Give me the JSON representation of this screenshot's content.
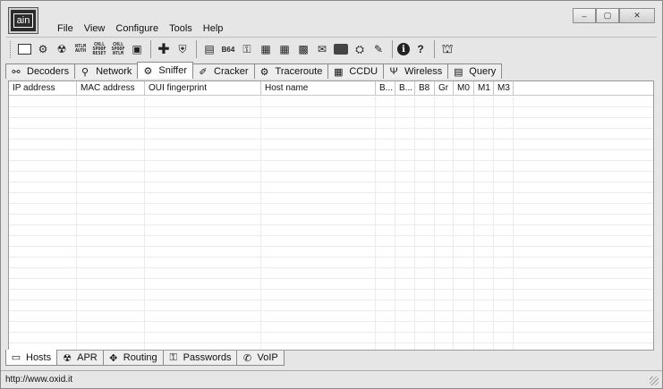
{
  "app": {
    "logo_text": "ain"
  },
  "menu": [
    "File",
    "View",
    "Configure",
    "Tools",
    "Help"
  ],
  "window_controls": {
    "minimize": "–",
    "maximize": "▢",
    "close": "✕"
  },
  "toolbar": [
    {
      "name": "open-icon",
      "glyph": "▭"
    },
    {
      "name": "start-sniffer-icon",
      "glyph": "⚙"
    },
    {
      "name": "radiation-icon",
      "glyph": "☢"
    },
    {
      "name": "ntlm-auth-icon",
      "glyph": "NTLM AUTH"
    },
    {
      "name": "chll-spoof-icon",
      "glyph": "CHLL SPOOF RESET"
    },
    {
      "name": "chll-spoof-ntlm-icon",
      "glyph": "CHLL SPOOF NTLM"
    },
    {
      "name": "monitor-icon",
      "glyph": "▣"
    },
    {
      "name": "add-icon",
      "glyph": "✚"
    },
    {
      "name": "shield-icon",
      "glyph": "⛨"
    },
    {
      "name": "document-icon",
      "glyph": "▤"
    },
    {
      "name": "base64-icon",
      "glyph": "B64"
    },
    {
      "name": "key-icon",
      "glyph": "⚿"
    },
    {
      "name": "hash-1-icon",
      "glyph": "▦"
    },
    {
      "name": "hash-2-icon",
      "glyph": "▦"
    },
    {
      "name": "calc-icon",
      "glyph": "▩"
    },
    {
      "name": "mail-icon",
      "glyph": "✉"
    },
    {
      "name": "terminal-icon",
      "glyph": "▬"
    },
    {
      "name": "certificate-icon",
      "glyph": "⛭"
    },
    {
      "name": "edit-icon",
      "glyph": "✎"
    },
    {
      "name": "info-icon",
      "glyph": "i"
    },
    {
      "name": "help-icon",
      "glyph": "?"
    },
    {
      "name": "exit-icon",
      "glyph": "⛫"
    }
  ],
  "tabs_top": [
    {
      "label": "Decoders",
      "icon": "decoders-icon",
      "glyph": "⚯"
    },
    {
      "label": "Network",
      "icon": "network-icon",
      "glyph": "⚲"
    },
    {
      "label": "Sniffer",
      "icon": "sniffer-icon",
      "glyph": "⚙",
      "active": true
    },
    {
      "label": "Cracker",
      "icon": "cracker-icon",
      "glyph": "✐"
    },
    {
      "label": "Traceroute",
      "icon": "traceroute-icon",
      "glyph": "⚙"
    },
    {
      "label": "CCDU",
      "icon": "ccdu-icon",
      "glyph": "▦"
    },
    {
      "label": "Wireless",
      "icon": "wireless-icon",
      "glyph": "Ψ"
    },
    {
      "label": "Query",
      "icon": "query-icon",
      "glyph": "▤"
    }
  ],
  "table": {
    "columns": [
      "IP address",
      "MAC address",
      "OUI fingerprint",
      "Host name",
      "B...",
      "B...",
      "B8",
      "Gr",
      "M0",
      "M1",
      "M3"
    ],
    "rows": []
  },
  "tabs_bottom": [
    {
      "label": "Hosts",
      "icon": "hosts-icon",
      "glyph": "▭",
      "active": true
    },
    {
      "label": "APR",
      "icon": "apr-icon",
      "glyph": "☢"
    },
    {
      "label": "Routing",
      "icon": "routing-icon",
      "glyph": "✥"
    },
    {
      "label": "Passwords",
      "icon": "passwords-icon",
      "glyph": "⚿"
    },
    {
      "label": "VoIP",
      "icon": "voip-icon",
      "glyph": "✆"
    }
  ],
  "status": {
    "text": "http://www.oxid.it"
  }
}
